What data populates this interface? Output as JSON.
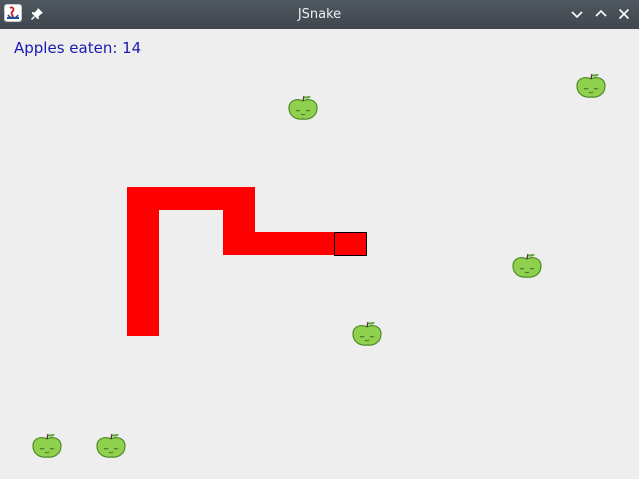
{
  "window": {
    "title": "JSnake",
    "icons": [
      "java-app-icon",
      "pin-icon",
      "minimize-icon",
      "maximize-icon",
      "close-icon"
    ]
  },
  "game": {
    "score_text": "Apples eaten: 14",
    "snake_color": "#ff0000",
    "apple_color": "#8fd14f",
    "score_color": "#1a1ab0",
    "background": "#eeeeee"
  }
}
